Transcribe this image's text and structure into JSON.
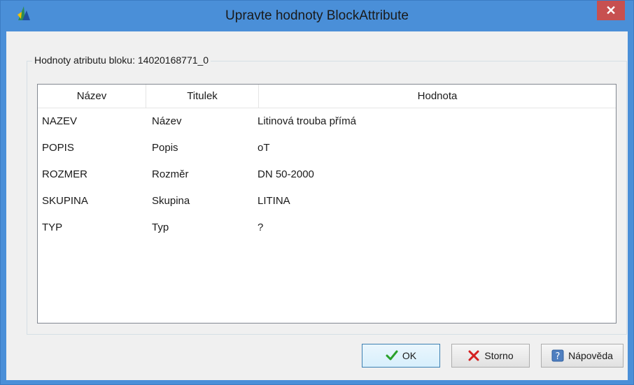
{
  "window": {
    "title": "Upravte hodnoty BlockAttribute",
    "close_glyph": "✕",
    "icon": "app-logo-icon"
  },
  "group": {
    "label": "Hodnoty atributu bloku: 14020168771_0"
  },
  "table": {
    "columns": [
      "Název",
      "Titulek",
      "Hodnota"
    ],
    "rows": [
      {
        "name": "NAZEV",
        "title": "Název",
        "value": "Litinová trouba přímá"
      },
      {
        "name": "POPIS",
        "title": "Popis",
        "value": "oT"
      },
      {
        "name": "ROZMER",
        "title": "Rozměr",
        "value": "DN 50-2000"
      },
      {
        "name": "SKUPINA",
        "title": "Skupina",
        "value": "LITINA"
      },
      {
        "name": "TYP",
        "title": "Typ",
        "value": "?"
      }
    ]
  },
  "buttons": {
    "ok": "OK",
    "cancel": "Storno",
    "help": "Nápověda",
    "ok_icon": "checkmark-icon",
    "cancel_icon": "red-x-icon",
    "help_icon": "help-question-icon"
  },
  "colors": {
    "titlebar": "#4a8fd8",
    "close": "#c75050",
    "client": "#f0f0f0"
  }
}
